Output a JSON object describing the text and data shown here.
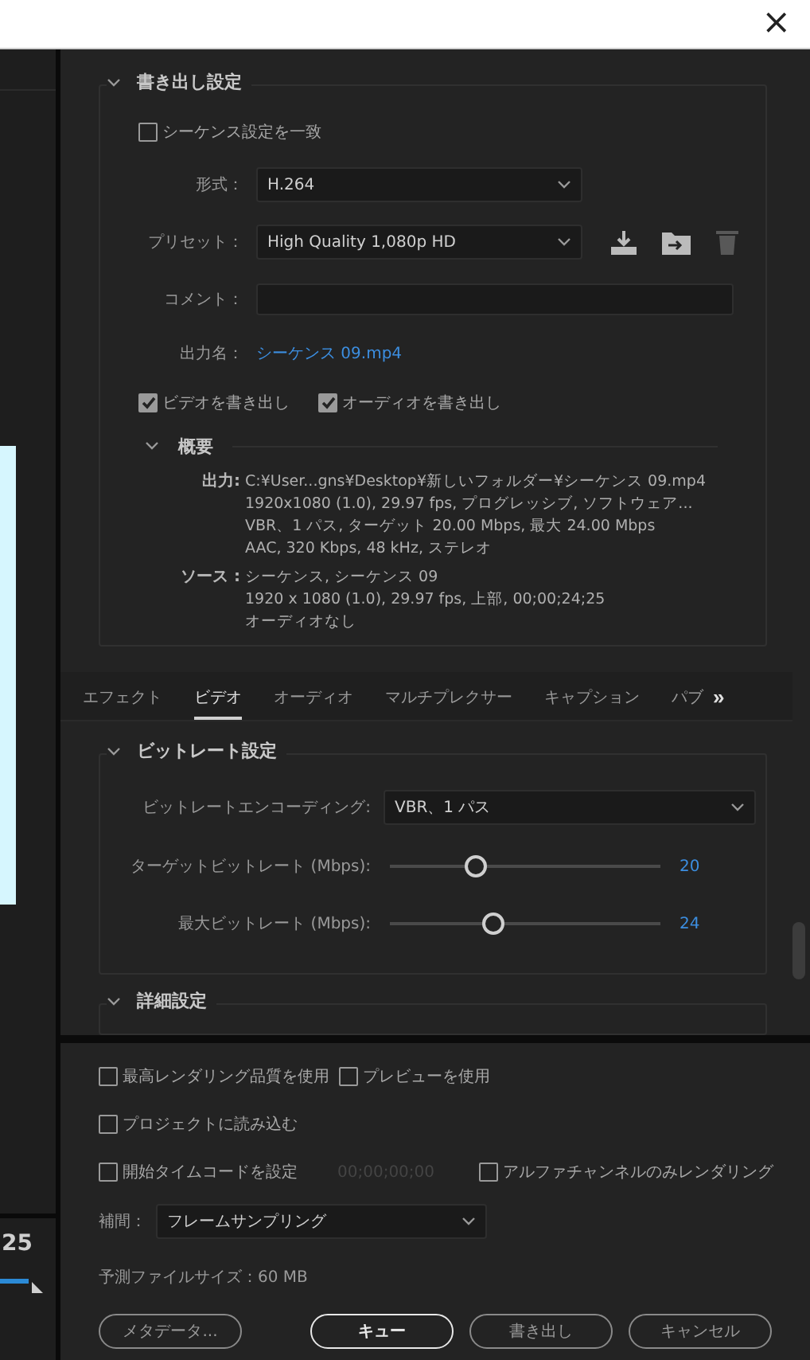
{
  "title_bar": {
    "close": "×"
  },
  "left_pane": {
    "timecode": "25"
  },
  "export_settings": {
    "title": "書き出し設定",
    "expanded": true,
    "match_sequence": {
      "label": "シーケンス設定を一致",
      "checked": false
    },
    "format": {
      "label": "形式：",
      "value": "H.264"
    },
    "preset": {
      "label": "プリセット：",
      "value": "High Quality 1,080p HD",
      "delete_disabled": true
    },
    "comment": {
      "label": "コメント："
    },
    "output_name": {
      "label": "出力名：",
      "value": "シーケンス 09.mp4"
    },
    "exports": [
      {
        "label": "ビデオを書き出し",
        "checked": true
      },
      {
        "label": "オーディオを書き出し",
        "checked": true
      }
    ],
    "summary": {
      "title": "概要",
      "expanded": true,
      "groups": [
        {
          "label": "出力:",
          "lines": [
            "C:¥User...gns¥Desktop¥新しいフォルダー¥シーケンス 09.mp4",
            "1920x1080 (1.0), 29.97 fps, プログレッシブ, ソフトウェア...",
            "VBR、1 パス, ターゲット 20.00 Mbps, 最大 24.00 Mbps",
            "AAC, 320 Kbps, 48 kHz, ステレオ"
          ]
        },
        {
          "label": "ソース :",
          "lines": [
            "シーケンス, シーケンス 09",
            "1920 x 1080 (1.0), 29.97 fps, 上部, 00;00;24;25",
            "オーディオなし"
          ]
        }
      ]
    }
  },
  "tabs": [
    {
      "label": "エフェクト",
      "selected": false
    },
    {
      "label": "ビデオ",
      "selected": true
    },
    {
      "label": "オーディオ",
      "selected": false
    },
    {
      "label": "マルチプレクサー",
      "selected": false
    },
    {
      "label": "キャプション",
      "selected": false
    },
    {
      "label": "パブ",
      "selected": false
    }
  ],
  "tabs_more": "»",
  "bitrate": {
    "title": "ビットレート設定",
    "expanded": true,
    "encoding": {
      "label": "ビットレートエンコーディング:",
      "value": "VBR、1 パス"
    },
    "sliders": [
      {
        "label": "ターゲットビットレート (Mbps):",
        "level": 0.32,
        "reading": "20"
      },
      {
        "label": "最大ビットレート (Mbps):",
        "level": 0.38,
        "reading": "24"
      }
    ]
  },
  "advanced": {
    "title": "詳細設定",
    "expanded": true
  },
  "options": [
    [
      {
        "label": "最高レンダリング品質を使用",
        "checked": false
      },
      {
        "label": "プレビューを使用",
        "checked": false
      }
    ],
    [
      {
        "label": "プロジェクトに読み込む",
        "checked": false
      }
    ],
    [
      {
        "label": "開始タイムコードを設定",
        "checked": false,
        "value": "00;00;00;00",
        "value_disabled": true
      },
      {
        "label": "アルファチャンネルのみレンダリング",
        "checked": false
      }
    ]
  ],
  "interpolation": {
    "label": "補間：",
    "value": "フレームサンプリング"
  },
  "estimated_size": "予測ファイルサイズ：60 MB",
  "buttons": [
    {
      "label": "メタデータ...",
      "primary": false
    },
    {
      "label": "キュー",
      "primary": true
    },
    {
      "label": "書き出し",
      "primary": false
    },
    {
      "label": "キャンセル",
      "primary": false
    }
  ]
}
